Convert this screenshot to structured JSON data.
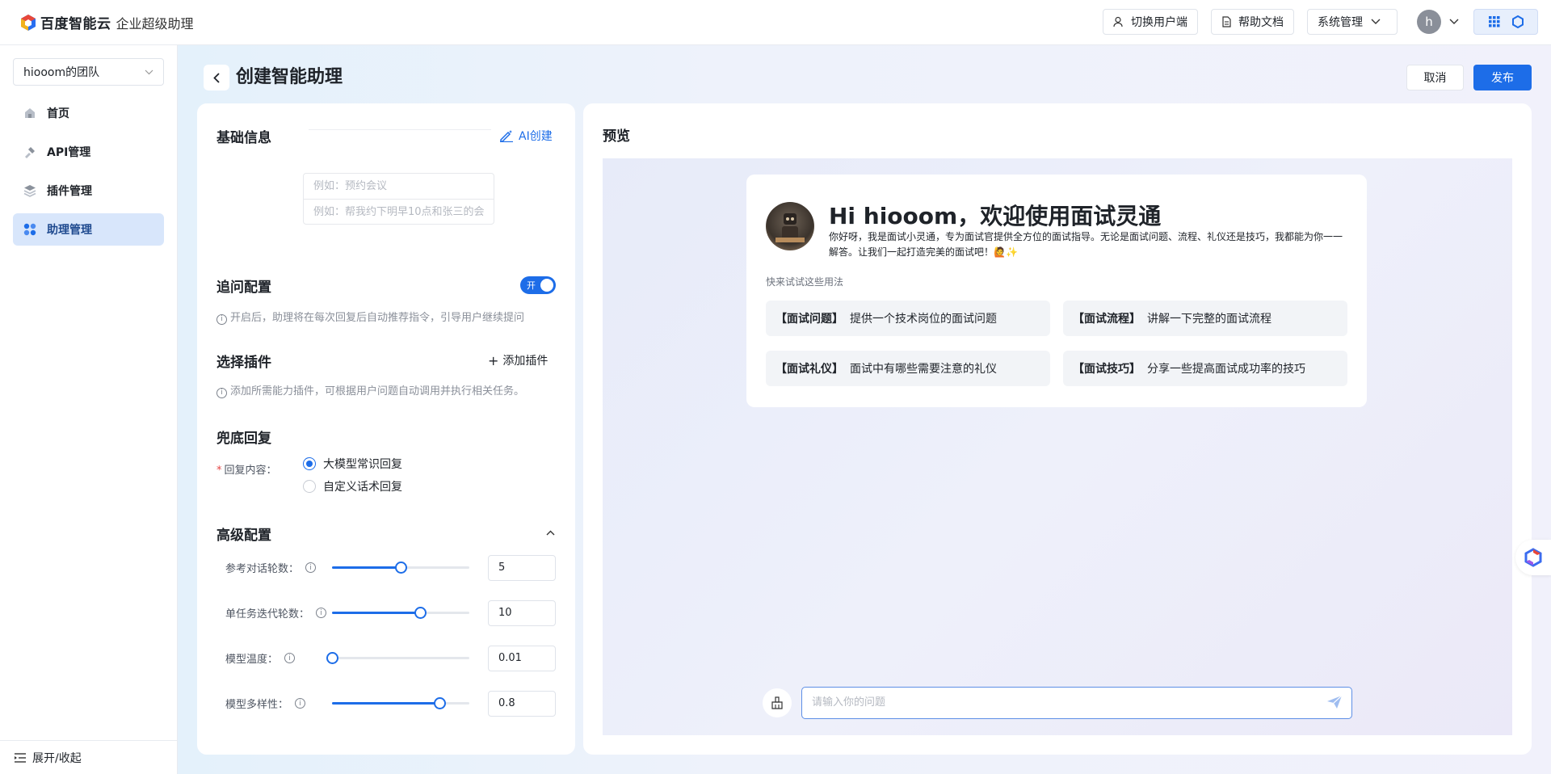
{
  "brand": {
    "name": "百度智能云",
    "product": "企业超级助理"
  },
  "topbar": {
    "switch_user": "切换用户端",
    "help_docs": "帮助文档",
    "system_mgmt": "系统管理",
    "avatar_initial": "h"
  },
  "sidebar": {
    "team": "hiooom的团队",
    "items": [
      {
        "label": "首页",
        "icon": "home-icon"
      },
      {
        "label": "API管理",
        "icon": "api-icon"
      },
      {
        "label": "插件管理",
        "icon": "plugin-icon"
      },
      {
        "label": "助理管理",
        "icon": "assistant-icon",
        "active": true
      }
    ],
    "footer": "展开/收起"
  },
  "header": {
    "title": "创建智能助理",
    "cancel": "取消",
    "publish": "发布"
  },
  "config": {
    "basic_title": "基础信息",
    "ai_create": "AI创建",
    "example_1": "例如：预约会议",
    "example_2": "例如：帮我约下明早10点和张三的会",
    "followup_title": "追问配置",
    "toggle_label": "开",
    "followup_desc": "开启后，助理将在每次回复后自动推荐指令，引导用户继续提问",
    "plugin_title": "选择插件",
    "add_plugin": "添加插件",
    "plugin_desc": "添加所需能力插件，可根据用户问题自动调用并执行相关任务。",
    "fallback_title": "兜底回复",
    "reply_label": "回复内容：",
    "radio_1": "大模型常识回复",
    "radio_2": "自定义话术回复",
    "advanced_title": "高级配置",
    "sliders": [
      {
        "label": "参考对话轮数：",
        "value": "5",
        "fraction": 0.5
      },
      {
        "label": "单任务迭代轮数：",
        "value": "10",
        "fraction": 0.64
      },
      {
        "label": "模型温度：",
        "value": "0.01",
        "fraction": 0.0
      },
      {
        "label": "模型多样性：",
        "value": "0.8",
        "fraction": 0.78
      }
    ]
  },
  "preview": {
    "title": "预览",
    "greeting": "Hi hiooom，欢迎使用面试灵通",
    "description": "你好呀，我是面试小灵通，专为面试官提供全方位的面试指导。无论是面试问题、流程、礼仪还是技巧，我都能为你一一解答。让我们一起打造完美的面试吧！🙋✨",
    "try_label": "快来试试这些用法",
    "suggestions": [
      {
        "tag": "【面试问题】",
        "text": "提供一个技术岗位的面试问题"
      },
      {
        "tag": "【面试流程】",
        "text": "讲解一下完整的面试流程"
      },
      {
        "tag": "【面试礼仪】",
        "text": "面试中有哪些需要注意的礼仪"
      },
      {
        "tag": "【面试技巧】",
        "text": "分享一些提高面试成功率的技巧"
      }
    ],
    "input_placeholder": "请输入你的问题"
  },
  "colors": {
    "accent": "#1d6de8",
    "active_nav_bg": "#d8e6fb"
  }
}
